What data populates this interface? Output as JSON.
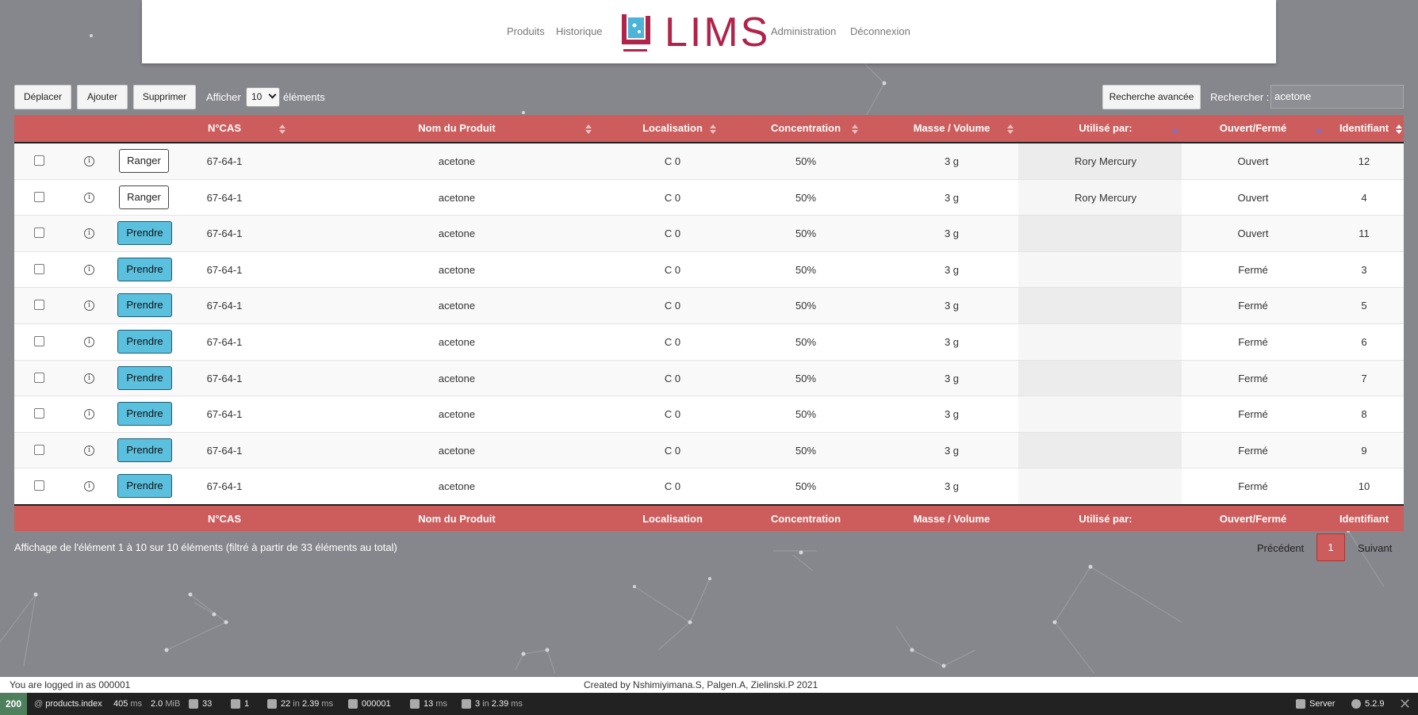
{
  "header": {
    "nav_left": [
      "Produits",
      "Historique"
    ],
    "logo_text": "LIMS",
    "nav_right": [
      "Administration",
      "Déconnexion"
    ]
  },
  "toolbar": {
    "move_label": "Déplacer",
    "add_label": "Ajouter",
    "delete_label": "Supprimer",
    "show_label": "Afficher",
    "page_size": "10",
    "elements_label": "éléments",
    "advanced_search_label": "Recherche avancée",
    "search_label": "Rechercher :",
    "search_value": "acetone"
  },
  "table": {
    "columns": [
      "N°CAS",
      "Nom du Produit",
      "Localisation",
      "Concentration",
      "Masse / Volume",
      "Utilisé par:",
      "Ouvert/Fermé",
      "Identifiant"
    ],
    "rows": [
      {
        "action": "Ranger",
        "cas": "67-64-1",
        "name": "acetone",
        "location": "C 0",
        "concentration": "50%",
        "mass": "3 g",
        "used_by": "Rory Mercury",
        "state": "Ouvert",
        "id": "12"
      },
      {
        "action": "Ranger",
        "cas": "67-64-1",
        "name": "acetone",
        "location": "C 0",
        "concentration": "50%",
        "mass": "3 g",
        "used_by": "Rory Mercury",
        "state": "Ouvert",
        "id": "4"
      },
      {
        "action": "Prendre",
        "cas": "67-64-1",
        "name": "acetone",
        "location": "C 0",
        "concentration": "50%",
        "mass": "3 g",
        "used_by": "",
        "state": "Ouvert",
        "id": "11"
      },
      {
        "action": "Prendre",
        "cas": "67-64-1",
        "name": "acetone",
        "location": "C 0",
        "concentration": "50%",
        "mass": "3 g",
        "used_by": "",
        "state": "Fermé",
        "id": "3"
      },
      {
        "action": "Prendre",
        "cas": "67-64-1",
        "name": "acetone",
        "location": "C 0",
        "concentration": "50%",
        "mass": "3 g",
        "used_by": "",
        "state": "Fermé",
        "id": "5"
      },
      {
        "action": "Prendre",
        "cas": "67-64-1",
        "name": "acetone",
        "location": "C 0",
        "concentration": "50%",
        "mass": "3 g",
        "used_by": "",
        "state": "Fermé",
        "id": "6"
      },
      {
        "action": "Prendre",
        "cas": "67-64-1",
        "name": "acetone",
        "location": "C 0",
        "concentration": "50%",
        "mass": "3 g",
        "used_by": "",
        "state": "Fermé",
        "id": "7"
      },
      {
        "action": "Prendre",
        "cas": "67-64-1",
        "name": "acetone",
        "location": "C 0",
        "concentration": "50%",
        "mass": "3 g",
        "used_by": "",
        "state": "Fermé",
        "id": "8"
      },
      {
        "action": "Prendre",
        "cas": "67-64-1",
        "name": "acetone",
        "location": "C 0",
        "concentration": "50%",
        "mass": "3 g",
        "used_by": "",
        "state": "Fermé",
        "id": "9"
      },
      {
        "action": "Prendre",
        "cas": "67-64-1",
        "name": "acetone",
        "location": "C 0",
        "concentration": "50%",
        "mass": "3 g",
        "used_by": "",
        "state": "Fermé",
        "id": "10"
      }
    ],
    "info": "Affichage de l'élément 1 à 10 sur 10 éléments (filtré à partir de 33 éléments au total)"
  },
  "pagination": {
    "previous_label": "Précédent",
    "current_page": "1",
    "next_label": "Suivant"
  },
  "footer": {
    "logged_in": "You are logged in as 000001",
    "credits": "Created by Nshimiyimana.S, Palgen.A, Zielinski.P 2021"
  },
  "devbar": {
    "status": "200",
    "route_prefix": "@",
    "route": "products.index",
    "time": "405",
    "time_unit": "ms",
    "memory": "2.0",
    "memory_unit": "MiB",
    "forms": "33",
    "logs": "1",
    "db_queries": "22",
    "db_in": "in",
    "db_time": "2.39",
    "db_unit": "ms",
    "user": "000001",
    "twig_time": "13",
    "twig_unit": "ms",
    "cache_calls": "3",
    "cache_in": "in",
    "cache_time": "2.39",
    "cache_unit": "ms",
    "server_label": "Server",
    "symfony_version": "5.2.9",
    "colors": {
      "status_bg": "#4f805d",
      "bar_bg": "#222222"
    }
  },
  "colors": {
    "header_red": "#cd5c5c",
    "prendre_blue": "#5bc0de",
    "logo_red": "#b0234a",
    "logo_blue": "#4bb4d8",
    "background": "#86878d"
  }
}
